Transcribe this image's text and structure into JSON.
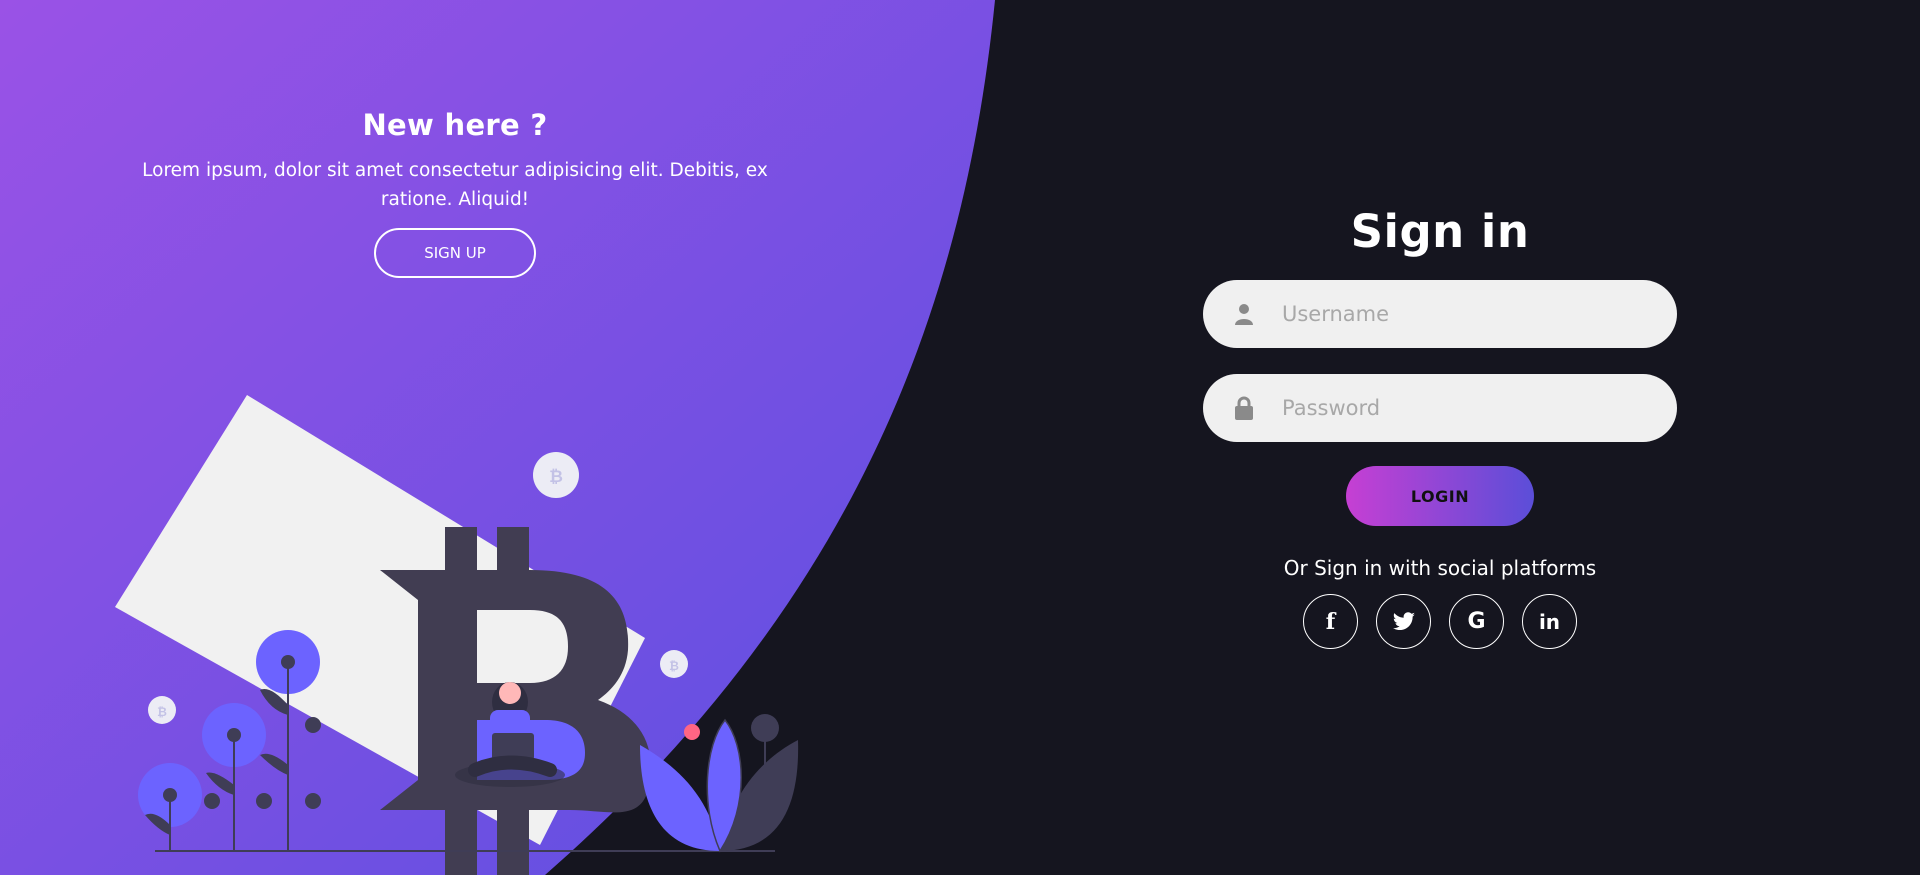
{
  "left_panel": {
    "title": "New here ?",
    "description": "Lorem ipsum, dolor sit amet consectetur adipisicing elit. Debitis, ex ratione. Aliquid!",
    "signup_label": "SIGN UP"
  },
  "signin": {
    "title": "Sign in",
    "username_placeholder": "Username",
    "password_placeholder": "Password",
    "login_label": "LOGIN",
    "social_text": "Or Sign in with social platforms",
    "social": [
      {
        "icon": "facebook-icon",
        "glyph": "f"
      },
      {
        "icon": "twitter-icon",
        "glyph": ""
      },
      {
        "icon": "google-icon",
        "glyph": "G"
      },
      {
        "icon": "linkedin-icon",
        "glyph": "in"
      }
    ]
  },
  "colors": {
    "background": "#15151f",
    "gradient_start": "#9b51e8",
    "gradient_end": "#5b4ee0",
    "login_start": "#c63fd3",
    "login_end": "#5b4ed8",
    "input_bg": "#f0f0f0"
  }
}
